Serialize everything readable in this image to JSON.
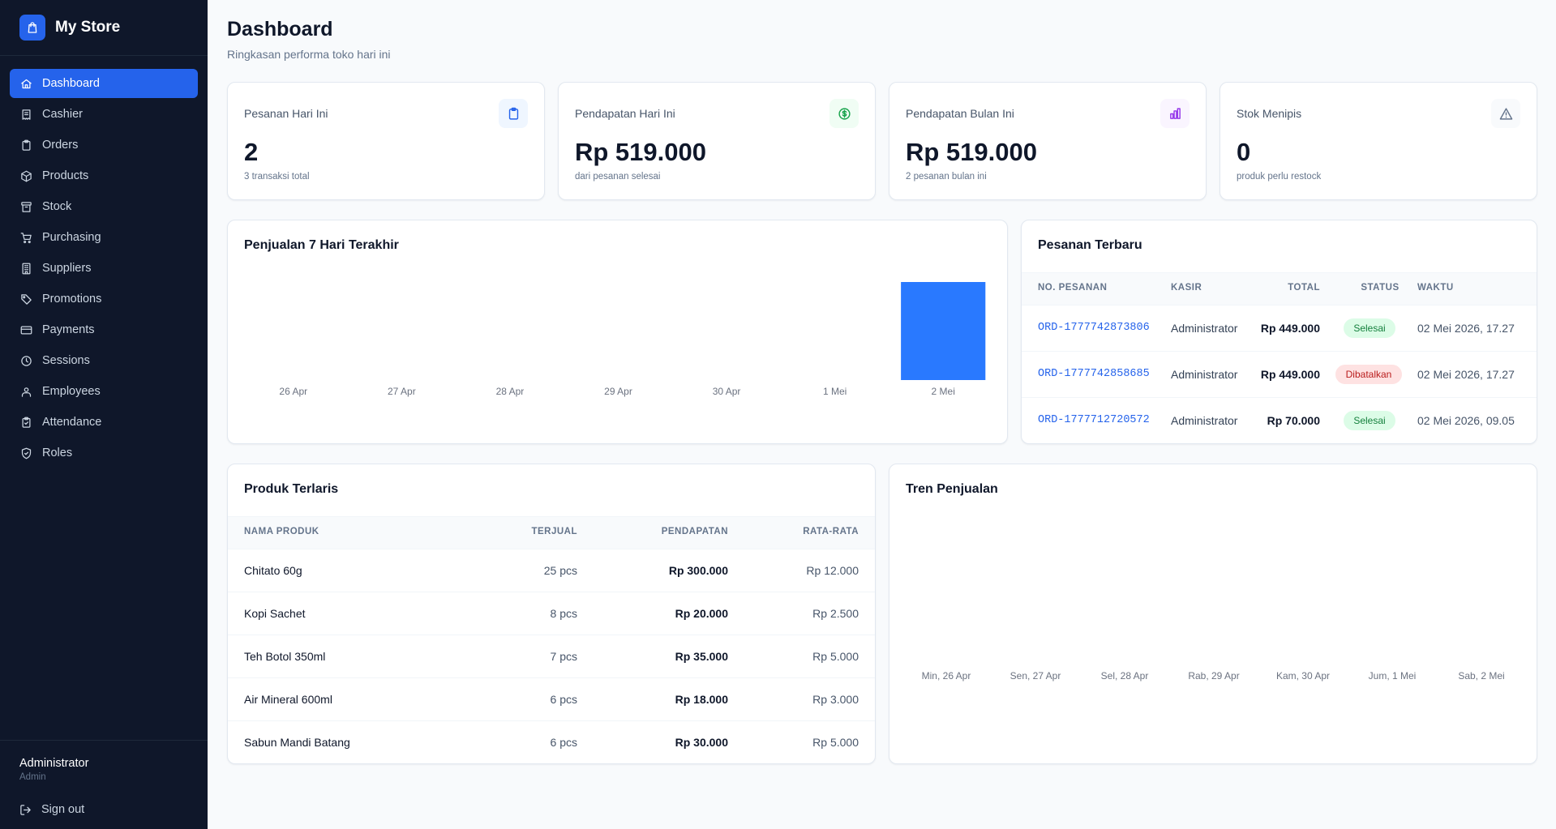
{
  "brand": {
    "name": "My Store"
  },
  "nav": [
    {
      "label": "Dashboard",
      "icon": "home-icon",
      "active": true
    },
    {
      "label": "Cashier",
      "icon": "receipt-icon"
    },
    {
      "label": "Orders",
      "icon": "clipboard-icon"
    },
    {
      "label": "Products",
      "icon": "package-icon"
    },
    {
      "label": "Stock",
      "icon": "archive-icon"
    },
    {
      "label": "Purchasing",
      "icon": "cart-icon"
    },
    {
      "label": "Suppliers",
      "icon": "building-icon"
    },
    {
      "label": "Promotions",
      "icon": "tag-icon"
    },
    {
      "label": "Payments",
      "icon": "credit-card-icon"
    },
    {
      "label": "Sessions",
      "icon": "clock-icon"
    },
    {
      "label": "Employees",
      "icon": "users-icon"
    },
    {
      "label": "Attendance",
      "icon": "clipboard-check-icon"
    },
    {
      "label": "Roles",
      "icon": "shield-icon"
    }
  ],
  "user": {
    "name": "Administrator",
    "role": "Admin",
    "signout": "Sign out"
  },
  "page": {
    "title": "Dashboard",
    "subtitle": "Ringkasan performa toko hari ini"
  },
  "stats": [
    {
      "label": "Pesanan Hari Ini",
      "value": "2",
      "hint": "3 transaksi total",
      "icon": "clipboard-icon",
      "color": "#2563eb",
      "bg": "#eff6ff"
    },
    {
      "label": "Pendapatan Hari Ini",
      "value": "Rp 519.000",
      "hint": "dari pesanan selesai",
      "icon": "dollar-circle-icon",
      "color": "#16a34a",
      "bg": "#f0fdf4"
    },
    {
      "label": "Pendapatan Bulan Ini",
      "value": "Rp 519.000",
      "hint": "2 pesanan bulan ini",
      "icon": "bar-chart-icon",
      "color": "#9333ea",
      "bg": "#faf5ff"
    },
    {
      "label": "Stok Menipis",
      "value": "0",
      "hint": "produk perlu restock",
      "icon": "alert-triangle-icon",
      "color": "#64748b",
      "bg": "#f8fafc"
    }
  ],
  "sales_chart": {
    "title": "Penjualan 7 Hari Terakhir"
  },
  "recent_orders": {
    "title": "Pesanan Terbaru",
    "headers": {
      "no": "NO. PESANAN",
      "cashier": "KASIR",
      "total": "TOTAL",
      "status": "STATUS",
      "time": "WAKTU"
    },
    "rows": [
      {
        "no": "ORD-1777742873806",
        "cashier": "Administrator",
        "total": "Rp 449.000",
        "status": "Selesai",
        "status_color": "#15803d",
        "status_bg": "#dcfce7",
        "time": "02 Mei 2026, 17.27"
      },
      {
        "no": "ORD-1777742858685",
        "cashier": "Administrator",
        "total": "Rp 449.000",
        "status": "Dibatalkan",
        "status_color": "#b91c1c",
        "status_bg": "#fee2e2",
        "time": "02 Mei 2026, 17.27"
      },
      {
        "no": "ORD-1777712720572",
        "cashier": "Administrator",
        "total": "Rp 70.000",
        "status": "Selesai",
        "status_color": "#15803d",
        "status_bg": "#dcfce7",
        "time": "02 Mei 2026, 09.05"
      }
    ]
  },
  "top_products": {
    "title": "Produk Terlaris",
    "headers": {
      "name": "NAMA PRODUK",
      "sold": "TERJUAL",
      "revenue": "PENDAPATAN",
      "avg": "RATA-RATA"
    },
    "rows": [
      {
        "name": "Chitato 60g",
        "sold": "25 pcs",
        "revenue": "Rp 300.000",
        "avg": "Rp 12.000"
      },
      {
        "name": "Kopi Sachet",
        "sold": "8 pcs",
        "revenue": "Rp 20.000",
        "avg": "Rp 2.500"
      },
      {
        "name": "Teh Botol 350ml",
        "sold": "7 pcs",
        "revenue": "Rp 35.000",
        "avg": "Rp 5.000"
      },
      {
        "name": "Air Mineral 600ml",
        "sold": "6 pcs",
        "revenue": "Rp 18.000",
        "avg": "Rp 3.000"
      },
      {
        "name": "Sabun Mandi Batang",
        "sold": "6 pcs",
        "revenue": "Rp 30.000",
        "avg": "Rp 5.000"
      }
    ]
  },
  "trend_chart": {
    "title": "Tren Penjualan"
  },
  "chart_data": [
    {
      "type": "bar",
      "title": "Penjualan 7 Hari Terakhir",
      "categories": [
        "26 Apr",
        "27 Apr",
        "28 Apr",
        "29 Apr",
        "30 Apr",
        "1 Mei",
        "2 Mei"
      ],
      "values": [
        0,
        0,
        0,
        0,
        0,
        0,
        519000
      ],
      "ylim": [
        0,
        519000
      ],
      "grid": false,
      "color": "#2979ff"
    },
    {
      "type": "line",
      "title": "Tren Penjualan",
      "categories": [
        "Min, 26 Apr",
        "Sen, 27 Apr",
        "Sel, 28 Apr",
        "Rab, 29 Apr",
        "Kam, 30 Apr",
        "Jum, 1 Mei",
        "Sab, 2 Mei"
      ],
      "values": [],
      "grid": false
    }
  ]
}
